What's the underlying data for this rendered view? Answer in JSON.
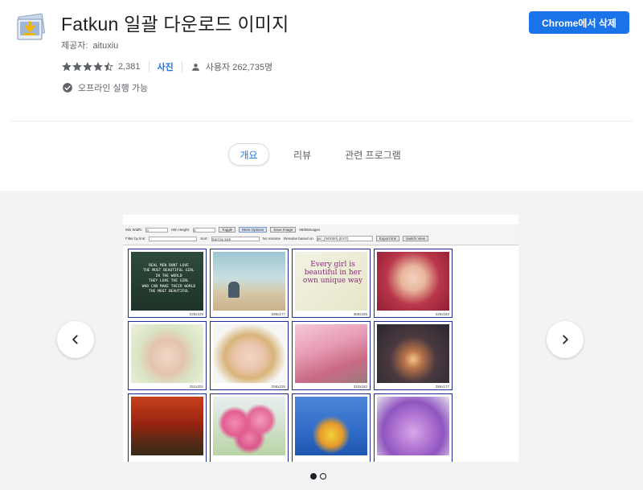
{
  "header": {
    "title": "Fatkun 일괄 다운로드 이미지",
    "provider_label": "제공자:",
    "provider_name": "aituxiu",
    "rating_value": 4.5,
    "rating_count": "2,381",
    "photos_label": "사진",
    "users_text": "사용자 262,735명",
    "offline_text": "오프라인 실행 가능",
    "remove_button": "Chrome에서 삭제"
  },
  "tabs": [
    {
      "label": "개요",
      "active": true
    },
    {
      "label": "리뷰",
      "active": false
    },
    {
      "label": "관련 프로그램",
      "active": false
    }
  ],
  "gallery": {
    "slide_count": 2,
    "active_slide": 0,
    "screenshot": {
      "toolbar": {
        "min_width_label": "Min Width:",
        "min_width_value": "0",
        "min_height_label": "Min Height:",
        "min_height_value": "0",
        "toggle_label": "Toggle",
        "more_options_label": "More Options",
        "save_image_label": "Save Image",
        "count_text": "68/68images",
        "filter_label": "Filter by link:",
        "sort_label": "Sort:",
        "sort_value": "Sort by size",
        "no_rename_label": "No rename",
        "rename_label": "Rename based on",
        "rename_value": "pic_{NO000}.{EXT}",
        "export_label": "Export link",
        "switch_label": "Switch View"
      },
      "quote_text": "REAL MEN DONT LOVE\nTHE MOST BEAUTIFUL GIRL\nIN THE WORLD\nTHEY LOVE THE GIRL\nWHO CAN MAKE THEIR WORLD\nTHE MOST BEAUTIFUL",
      "girl_text": "Every girl is\nbeautiful in her\nown unique way",
      "thumbnails": [
        {
          "size": "225x225"
        },
        {
          "size": "286x177"
        },
        {
          "size": "369x336"
        },
        {
          "size": "225x183"
        },
        {
          "size": "251x201"
        },
        {
          "size": "258x235"
        },
        {
          "size": "310x162"
        },
        {
          "size": "286x177"
        },
        {
          "size": ""
        },
        {
          "size": ""
        },
        {
          "size": ""
        },
        {
          "size": ""
        }
      ]
    }
  },
  "colors": {
    "accent": "#1a73e8",
    "star": "#5f6368",
    "gallery_bg": "#f1f3f4",
    "thumb_border": "#1f2b8f"
  },
  "icons": {
    "extension": "download-image-icon",
    "users": "person-icon",
    "offline": "offline-check-icon",
    "prev": "chevron-left-icon",
    "next": "chevron-right-icon"
  }
}
